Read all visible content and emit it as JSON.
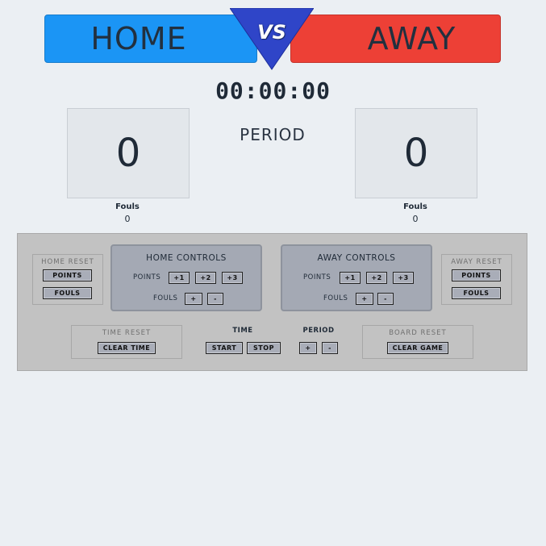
{
  "banner": {
    "home": "HOME",
    "vs": "VS",
    "away": "AWAY"
  },
  "timer": "00:00:00",
  "scoreboard": {
    "home_score": "0",
    "away_score": "0",
    "period_label": "PERIOD",
    "home_fouls_label": "Fouls",
    "home_fouls": "0",
    "away_fouls_label": "Fouls",
    "away_fouls": "0"
  },
  "controls": {
    "home_reset": {
      "title": "HOME RESET",
      "points": "POINTS",
      "fouls": "FOULS"
    },
    "away_reset": {
      "title": "AWAY RESET",
      "points": "POINTS",
      "fouls": "FOULS"
    },
    "home_controls": {
      "title": "HOME CONTROLS",
      "points_label": "POINTS",
      "p1": "+1",
      "p2": "+2",
      "p3": "+3",
      "fouls_label": "FOULS",
      "plus": "+",
      "minus": "-"
    },
    "away_controls": {
      "title": "AWAY CONTROLS",
      "points_label": "POINTS",
      "p1": "+1",
      "p2": "+2",
      "p3": "+3",
      "fouls_label": "FOULS",
      "plus": "+",
      "minus": "-"
    },
    "time_reset": {
      "title": "TIME RESET",
      "clear": "CLEAR TIME"
    },
    "time": {
      "label": "TIME",
      "start": "START",
      "stop": "STOP"
    },
    "period": {
      "label": "PERIOD",
      "plus": "+",
      "minus": "-"
    },
    "board_reset": {
      "title": "BOARD RESET",
      "clear": "CLEAR GAME"
    }
  },
  "colors": {
    "home": "#1b95f5",
    "away": "#ed4036",
    "vs": "#2f45c8",
    "page_bg": "#ebeff3"
  }
}
